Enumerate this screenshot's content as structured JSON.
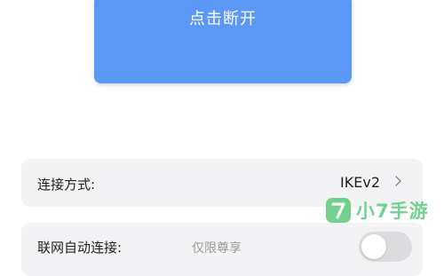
{
  "primary_button": {
    "label": "点击断开",
    "color": "#5b97f4"
  },
  "settings": {
    "connection_method": {
      "label": "连接方式:",
      "value": "IKEv2",
      "icon": "chevron-right-icon"
    },
    "auto_connect": {
      "label": "联网自动连接:",
      "hint": "仅限尊享",
      "enabled": false
    }
  },
  "watermark": {
    "text": "小7手游",
    "badge_glyph": "7",
    "color": "#6ad08a"
  }
}
